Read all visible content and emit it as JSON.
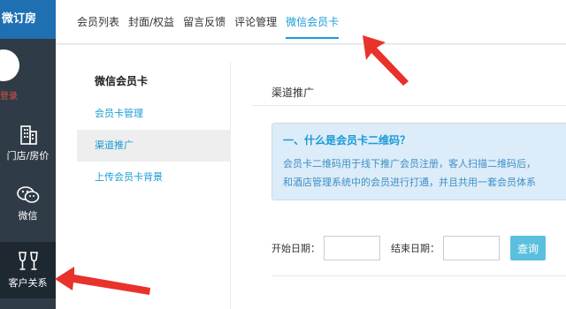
{
  "sidebar": {
    "brand": "微订房",
    "login_text": "登录",
    "items": [
      {
        "label": "门店/房价",
        "icon": "building-icon"
      },
      {
        "label": "微信",
        "icon": "wechat-icon"
      },
      {
        "label": "客户关系",
        "icon": "wine-glasses-icon"
      }
    ]
  },
  "tabs": [
    {
      "label": "会员列表",
      "active": false
    },
    {
      "label": "封面/权益",
      "active": false
    },
    {
      "label": "留言反馈",
      "active": false
    },
    {
      "label": "评论管理",
      "active": false
    },
    {
      "label": "微信会员卡",
      "active": true
    }
  ],
  "subnav": {
    "title": "微信会员卡",
    "items": [
      {
        "label": "会员卡管理",
        "active": false
      },
      {
        "label": "渠道推广",
        "active": true
      },
      {
        "label": "上传会员卡背景",
        "active": false
      }
    ]
  },
  "panel": {
    "title": "渠道推广",
    "info": {
      "question": "一、什么是会员卡二维码？",
      "line1": "会员卡二维码用于线下推广会员注册，客人扫描二维码后，",
      "line2": "和酒店管理系统中的会员进行打通，并且共用一套会员体系"
    },
    "filter": {
      "start_label": "开始日期：",
      "end_label": "结束日期：",
      "query_button": "查询"
    }
  },
  "colors": {
    "accent": "#1a9bd7",
    "sidebar_bg": "#2f3b47",
    "brand_bg": "#1f6fb3",
    "annotation_arrow": "#e8322b"
  }
}
